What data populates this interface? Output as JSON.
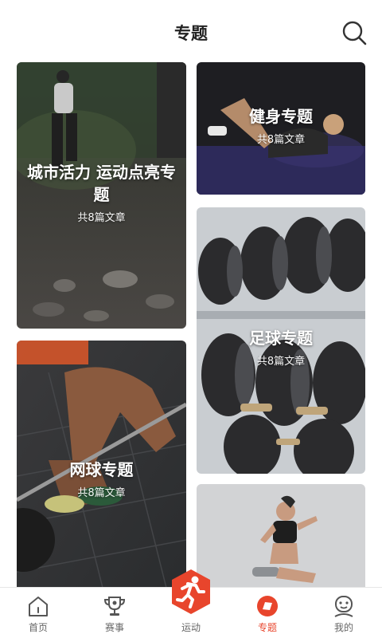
{
  "header": {
    "title": "专题",
    "search_icon": "search-icon"
  },
  "cards": [
    {
      "title": "城市活力 运动点亮专题",
      "subtitle": "共8篇文章"
    },
    {
      "title": "健身专题",
      "subtitle": "共8篇文章"
    },
    {
      "title": "网球专题",
      "subtitle": "共8篇文章"
    },
    {
      "title": "足球专题",
      "subtitle": "共8篇文章"
    }
  ],
  "tabs": [
    {
      "label": "首页",
      "icon": "home-icon"
    },
    {
      "label": "赛事",
      "icon": "trophy-icon"
    },
    {
      "label": "运动",
      "icon": "running-icon"
    },
    {
      "label": "专题",
      "icon": "topic-icon",
      "active": true
    },
    {
      "label": "我的",
      "icon": "profile-icon"
    }
  ],
  "colors": {
    "accent": "#e8452c",
    "text": "#222222",
    "tab_inactive": "#666666"
  }
}
